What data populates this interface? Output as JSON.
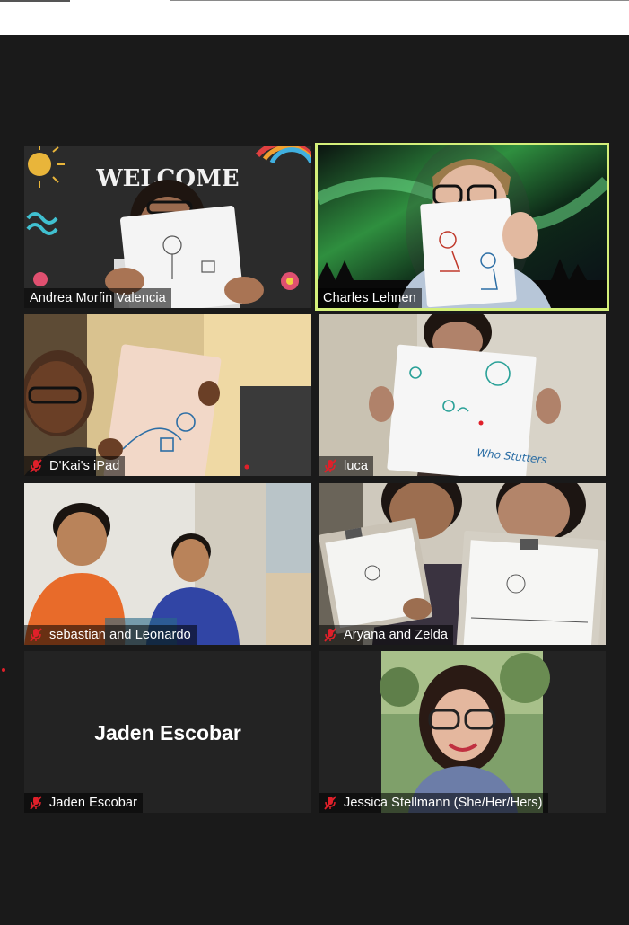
{
  "meeting": {
    "participants": [
      {
        "name": "Andrea Morfin Valencia",
        "muted": false,
        "video": true,
        "active_speaker": false
      },
      {
        "name": "Charles Lehnen",
        "muted": false,
        "video": true,
        "active_speaker": true
      },
      {
        "name": "D'Kai's iPad",
        "muted": true,
        "video": true,
        "active_speaker": false
      },
      {
        "name": "luca",
        "muted": true,
        "video": true,
        "active_speaker": false
      },
      {
        "name": "sebastian and Leonardo",
        "muted": true,
        "video": true,
        "active_speaker": false
      },
      {
        "name": "Aryana and Zelda",
        "muted": true,
        "video": true,
        "active_speaker": false
      },
      {
        "name": "Jaden Escobar",
        "muted": true,
        "video": false,
        "active_speaker": false,
        "placeholder_name": "Jaden Escobar"
      },
      {
        "name": "Jessica Stellmann (She/Her/Hers)",
        "muted": true,
        "video": true,
        "active_speaker": false
      }
    ]
  },
  "tile1_background_text": "WELCOME",
  "drawing_text": "Who Stutters",
  "colors": {
    "background": "#1a1a1a",
    "active_speaker_border": "#d4f07a",
    "mute_icon": "#e0202a",
    "name_text": "#ffffff"
  },
  "icons": {
    "muted": "microphone-muted-icon"
  }
}
